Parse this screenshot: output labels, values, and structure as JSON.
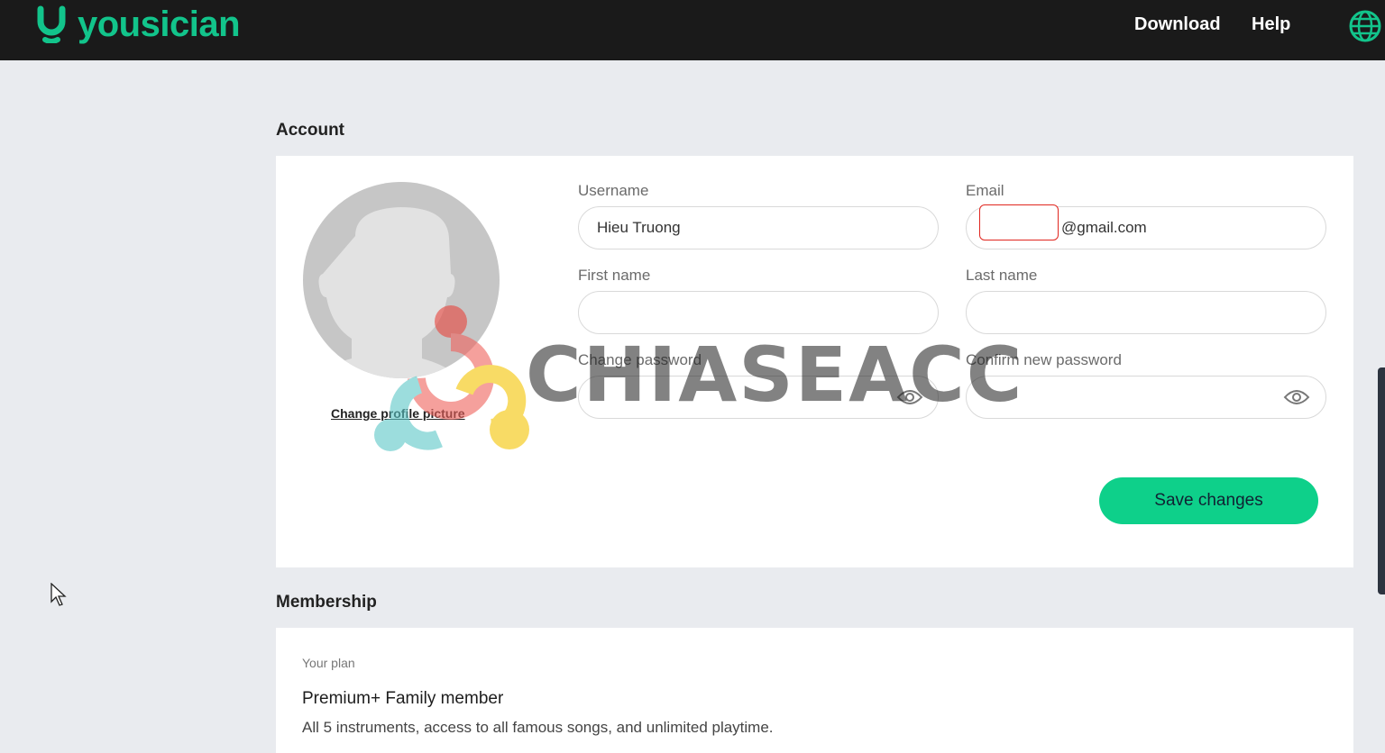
{
  "brand": {
    "name": "yousician",
    "color": "#12c48b"
  },
  "nav": {
    "download": "Download",
    "help": "Help",
    "language_icon": "globe-icon"
  },
  "account": {
    "section_title": "Account",
    "change_picture_label": "Change profile picture",
    "username": {
      "label": "Username",
      "value": "Hieu Truong"
    },
    "email": {
      "label": "Email",
      "value": "@gmail.com"
    },
    "first_name": {
      "label": "First name",
      "value": ""
    },
    "last_name": {
      "label": "Last name",
      "value": ""
    },
    "change_password": {
      "label": "Change password",
      "value": ""
    },
    "confirm_password": {
      "label": "Confirm new password",
      "value": ""
    },
    "save_label": "Save changes"
  },
  "membership": {
    "section_title": "Membership",
    "plan_label": "Your plan",
    "plan_name": "Premium+ Family member",
    "plan_description": "All 5 instruments, access to all famous songs, and unlimited playtime."
  },
  "watermark": {
    "text": "CHIASEACC"
  },
  "colors": {
    "accent": "#0ed08a",
    "topbar": "#1a1a1a",
    "background": "#e9ebef"
  }
}
